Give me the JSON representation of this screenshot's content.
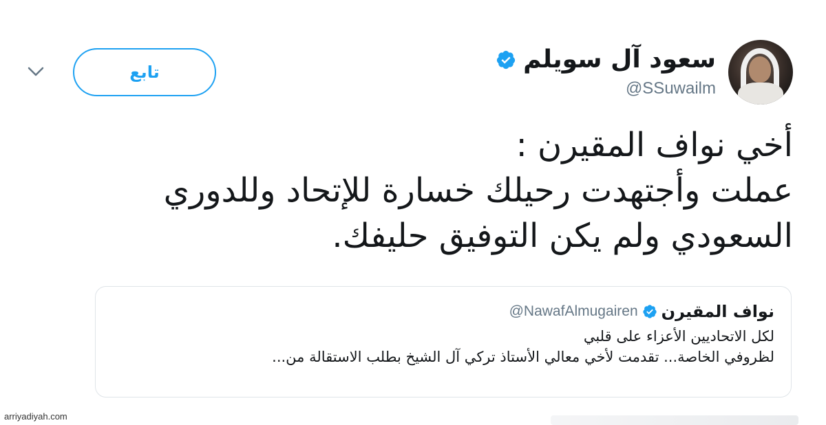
{
  "author": {
    "display_name": "سعود آل سويلم",
    "handle": "@SSuwailm"
  },
  "follow_button": {
    "label": "تابع"
  },
  "tweet": {
    "lines": [
      "أخي نواف المقيرن :",
      "عملت وأجتهدت رحيلك خسارة للإتحاد وللدوري",
      "السعودي ولم يكن التوفيق حليفك."
    ]
  },
  "quoted_tweet": {
    "display_name": "نواف المقيرن",
    "handle": "@NawafAlmugairen",
    "lines": [
      "لكل الاتحاديين الأعزاء على قلبي",
      "لظروفي الخاصة... تقدمت لأخي معالي الأستاذ تركي آل الشيخ بطلب الاستقالة من..."
    ]
  },
  "watermark": "arriyadiyah.com",
  "colors": {
    "accent": "#1da1f2",
    "text": "#14171a",
    "secondary": "#657786",
    "border": "#dfe4e8"
  },
  "icons": {
    "verified": "verified-badge-icon",
    "chevron": "chevron-down-icon"
  }
}
